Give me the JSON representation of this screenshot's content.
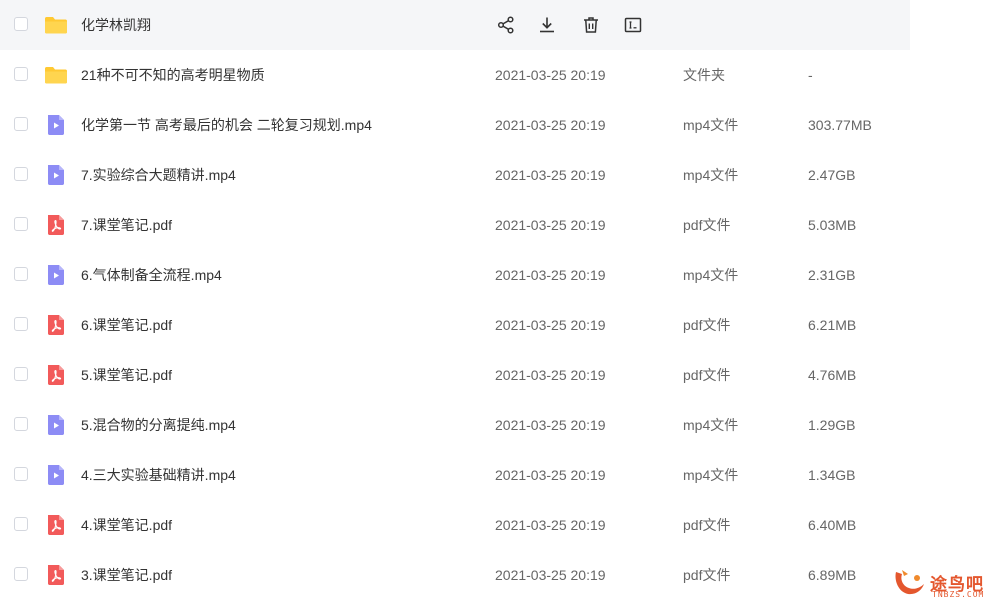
{
  "files": [
    {
      "name": "化学林凯翔",
      "time": "",
      "type": "",
      "size": "",
      "icon": "folder-icon"
    },
    {
      "name": "21种不可不知的高考明星物质",
      "time": "2021-03-25 20:19",
      "type": "文件夹",
      "size": "-",
      "icon": "folder-icon"
    },
    {
      "name": "化学第一节 高考最后的机会 二轮复习规划.mp4",
      "time": "2021-03-25 20:19",
      "type": "mp4文件",
      "size": "303.77MB",
      "icon": "video-file-icon"
    },
    {
      "name": "7.实验综合大题精讲.mp4",
      "time": "2021-03-25 20:19",
      "type": "mp4文件",
      "size": "2.47GB",
      "icon": "video-file-icon"
    },
    {
      "name": "7.课堂笔记.pdf",
      "time": "2021-03-25 20:19",
      "type": "pdf文件",
      "size": "5.03MB",
      "icon": "pdf-file-icon"
    },
    {
      "name": "6.气体制备全流程.mp4",
      "time": "2021-03-25 20:19",
      "type": "mp4文件",
      "size": "2.31GB",
      "icon": "video-file-icon"
    },
    {
      "name": "6.课堂笔记.pdf",
      "time": "2021-03-25 20:19",
      "type": "pdf文件",
      "size": "6.21MB",
      "icon": "pdf-file-icon"
    },
    {
      "name": "5.课堂笔记.pdf",
      "time": "2021-03-25 20:19",
      "type": "pdf文件",
      "size": "4.76MB",
      "icon": "pdf-file-icon"
    },
    {
      "name": "5.混合物的分离提纯.mp4",
      "time": "2021-03-25 20:19",
      "type": "mp4文件",
      "size": "1.29GB",
      "icon": "video-file-icon"
    },
    {
      "name": "4.三大实验基础精讲.mp4",
      "time": "2021-03-25 20:19",
      "type": "mp4文件",
      "size": "1.34GB",
      "icon": "video-file-icon"
    },
    {
      "name": "4.课堂笔记.pdf",
      "time": "2021-03-25 20:19",
      "type": "pdf文件",
      "size": "6.40MB",
      "icon": "pdf-file-icon"
    },
    {
      "name": "3.课堂笔记.pdf",
      "time": "2021-03-25 20:19",
      "type": "pdf文件",
      "size": "6.89MB",
      "icon": "pdf-file-icon"
    }
  ],
  "row_actions": [
    "share-icon",
    "download-icon",
    "delete-icon",
    "rename-icon"
  ],
  "watermark": {
    "text": "途鸟吧",
    "sub": "TNBZS.COM"
  },
  "colors": {
    "folder": "#FFC933",
    "video": "#8D8CF5",
    "pdf": "#F25A5A",
    "hover_row": "#F5F6F8",
    "watermark": "#E4572E"
  }
}
